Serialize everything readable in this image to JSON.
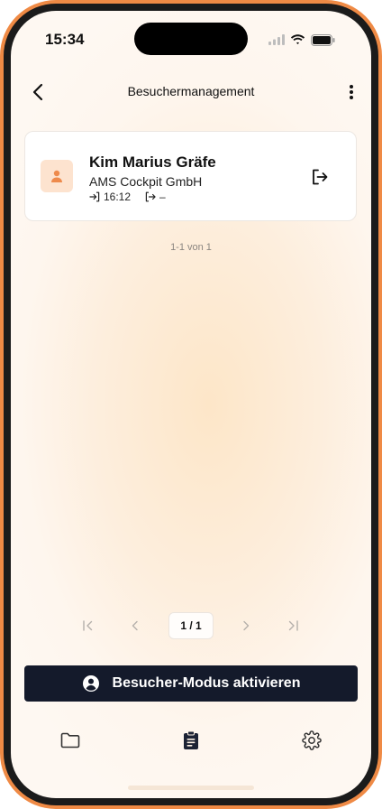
{
  "status_bar": {
    "time": "15:34"
  },
  "nav": {
    "title": "Besuchermanagement"
  },
  "visitor_card": {
    "name": "Kim Marius Gräfe",
    "company": "AMS Cockpit GmbH",
    "check_in_time": "16:12",
    "check_out_time": "–"
  },
  "list": {
    "result_count": "1-1 von 1"
  },
  "pagination": {
    "current": "1 / 1"
  },
  "cta": {
    "label": "Besucher-Modus aktivieren"
  },
  "tabs": [
    {
      "icon": "folder-icon"
    },
    {
      "icon": "clipboard-icon"
    },
    {
      "icon": "gear-icon"
    }
  ],
  "colors": {
    "accent": "#ef8a45",
    "cta_background": "#141a2b",
    "avatar_background": "#fde3cf"
  }
}
